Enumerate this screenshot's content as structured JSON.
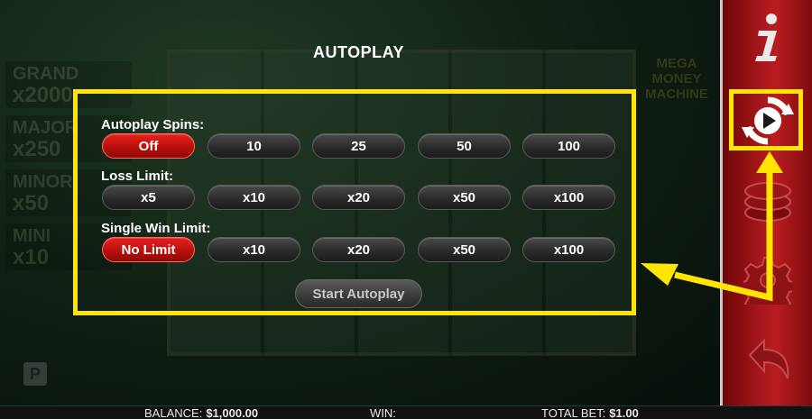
{
  "background": {
    "jackpots": [
      {
        "name": "GRAND",
        "value": "x2000"
      },
      {
        "name": "MAJOR",
        "value": "x250"
      },
      {
        "name": "MINOR",
        "value": "x50"
      },
      {
        "name": "MINI",
        "value": "x10"
      }
    ],
    "logo_text": "MEGA MONEY MACHINE",
    "p_badge": "P"
  },
  "dialog": {
    "title": "AUTOPLAY",
    "autoplay_spins": {
      "label": "Autoplay Spins:",
      "options": [
        "Off",
        "10",
        "25",
        "50",
        "100"
      ],
      "selected": "Off"
    },
    "loss_limit": {
      "label": "Loss Limit:",
      "options": [
        "x5",
        "x10",
        "x20",
        "x50",
        "x100"
      ],
      "selected": null
    },
    "single_win_limit": {
      "label": "Single Win Limit:",
      "options": [
        "No Limit",
        "x10",
        "x20",
        "x50",
        "x100"
      ],
      "selected": "No Limit"
    },
    "start_button": "Start Autoplay"
  },
  "sidebar": {
    "icons": [
      "info-icon",
      "autoplay-icon",
      "coin-stack-icon",
      "gear-icon",
      "back-arrow-icon"
    ]
  },
  "bottom_bar": {
    "balance_label": "BALANCE:",
    "balance_value": "$1,000.00",
    "win_label": "WIN:",
    "win_value": "",
    "total_bet_label": "TOTAL BET:",
    "total_bet_value": "$1.00"
  },
  "colors": {
    "highlight": "#ffe500",
    "selected_button": "#c8150f",
    "sidebar": "#a4161a"
  }
}
